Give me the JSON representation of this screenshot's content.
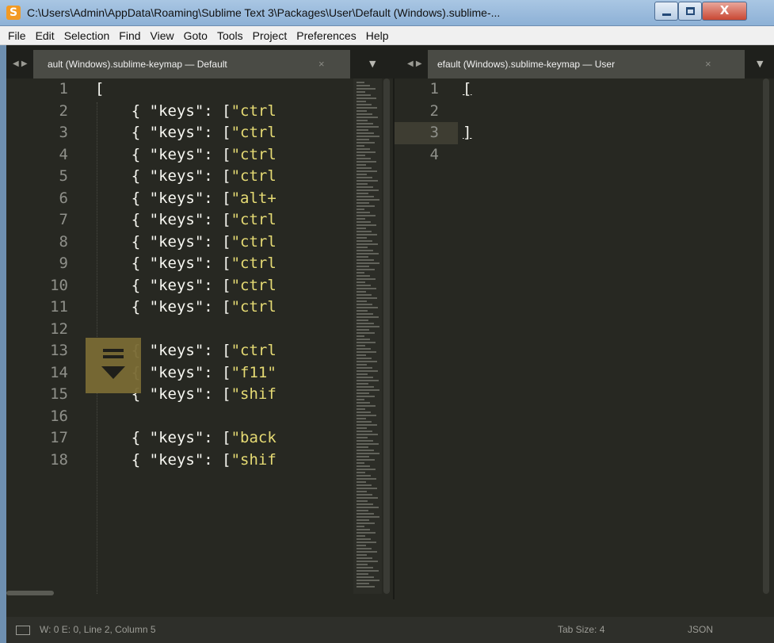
{
  "window": {
    "title": "C:\\Users\\Admin\\AppData\\Roaming\\Sublime Text 3\\Packages\\User\\Default (Windows).sublime-...",
    "close_glyph": "X"
  },
  "menu": [
    "File",
    "Edit",
    "Selection",
    "Find",
    "View",
    "Goto",
    "Tools",
    "Project",
    "Preferences",
    "Help"
  ],
  "tabs": {
    "left": {
      "label": "ault (Windows).sublime-keymap — Default",
      "close": "×"
    },
    "right": {
      "label": "efault (Windows).sublime-keymap — User",
      "close": "×"
    }
  },
  "left_pane": {
    "line_numbers": [
      "1",
      "2",
      "3",
      "4",
      "5",
      "6",
      "7",
      "8",
      "9",
      "10",
      "11",
      "12",
      "13",
      "14",
      "15",
      "16",
      "17",
      "18"
    ],
    "lines": [
      {
        "text": "[",
        "str": ""
      },
      {
        "text": "    { \"keys\": [",
        "str": "\"ctrl"
      },
      {
        "text": "    { \"keys\": [",
        "str": "\"ctrl"
      },
      {
        "text": "    { \"keys\": [",
        "str": "\"ctrl"
      },
      {
        "text": "    { \"keys\": [",
        "str": "\"ctrl"
      },
      {
        "text": "    { \"keys\": [",
        "str": "\"alt+"
      },
      {
        "text": "    { \"keys\": [",
        "str": "\"ctrl"
      },
      {
        "text": "    { \"keys\": [",
        "str": "\"ctrl"
      },
      {
        "text": "    { \"keys\": [",
        "str": "\"ctrl"
      },
      {
        "text": "    { \"keys\": [",
        "str": "\"ctrl"
      },
      {
        "text": "    { \"keys\": [",
        "str": "\"ctrl"
      },
      {
        "text": "",
        "str": ""
      },
      {
        "text": "    { \"keys\": [",
        "str": "\"ctrl"
      },
      {
        "text": "    { \"keys\": [",
        "str": "\"f11\""
      },
      {
        "text": "    { \"keys\": [",
        "str": "\"shif"
      },
      {
        "text": "",
        "str": ""
      },
      {
        "text": "    { \"keys\": [",
        "str": "\"back"
      },
      {
        "text": "    { \"keys\": [",
        "str": "\"shif"
      }
    ]
  },
  "right_pane": {
    "line_numbers": [
      "1",
      "2",
      "3",
      "4"
    ],
    "lines": [
      "[",
      "",
      "]",
      ""
    ]
  },
  "status": {
    "text": "W: 0 E: 0, Line 2, Column 5",
    "tab_size": "Tab Size: 4",
    "syntax": "JSON"
  },
  "icons": {
    "app": "sublime-text-logo",
    "fold": "fold-marker-icon",
    "status": "panel-switcher-icon"
  },
  "colors": {
    "editor_bg": "#272822",
    "string": "#e6db74",
    "text": "#f8f8f2",
    "gutter": "#8f908a"
  }
}
